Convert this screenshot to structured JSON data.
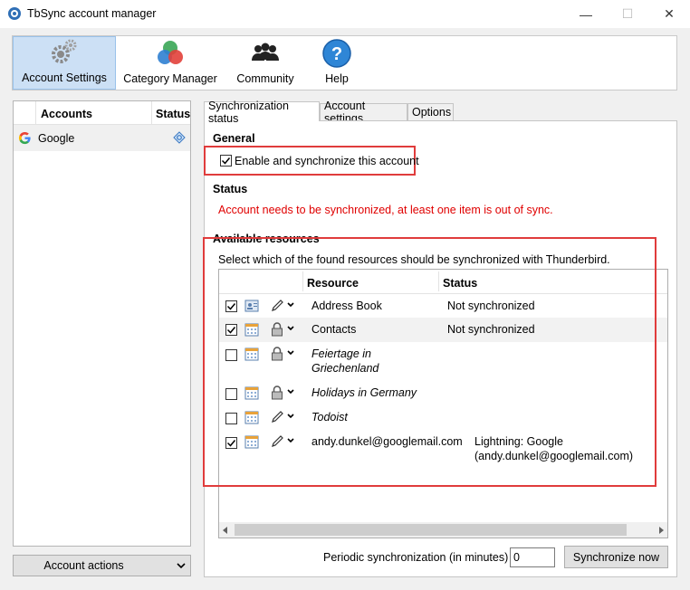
{
  "window": {
    "title": "TbSync account manager",
    "minimize": "—",
    "maximize": "☐",
    "close": "✕"
  },
  "toolbar": {
    "account_settings": "Account Settings",
    "category_manager": "Category Manager",
    "community": "Community",
    "help": "Help"
  },
  "accounts": {
    "col_accounts": "Accounts",
    "col_status": "Status",
    "items": [
      {
        "name": "Google",
        "icon": "google-icon",
        "status_icon": "sync-status-icon"
      }
    ],
    "actions_label": "Account actions"
  },
  "tabs": [
    "Synchronization status",
    "Account settings",
    "Options"
  ],
  "general": {
    "heading": "General",
    "enable_label": "Enable and synchronize this account",
    "enabled": true
  },
  "status": {
    "heading": "Status",
    "message": "Account needs to be synchronized, at least one item is out of sync.",
    "message_color": "#e00000"
  },
  "resources": {
    "heading": "Available resources",
    "description": "Select which of the found resources should be synchronized with Thunderbird.",
    "col_resource": "Resource",
    "col_status": "Status",
    "rows": [
      {
        "checked": true,
        "type_icon": "address-book-icon",
        "access_icon": "pencil-icon",
        "name": "Address Book",
        "status": "Not synchronized",
        "italic": false
      },
      {
        "checked": true,
        "type_icon": "calendar-icon",
        "access_icon": "lock-icon",
        "name": "Contacts",
        "status": "Not synchronized",
        "italic": false
      },
      {
        "checked": false,
        "type_icon": "calendar-icon",
        "access_icon": "lock-icon",
        "name_line1": "Feiertage in",
        "name_line2": "Griechenland",
        "status": "",
        "italic": true
      },
      {
        "checked": false,
        "type_icon": "calendar-icon",
        "access_icon": "lock-icon",
        "name": "Holidays in Germany",
        "status": "",
        "italic": true
      },
      {
        "checked": false,
        "type_icon": "calendar-icon",
        "access_icon": "pencil-icon",
        "name": "Todoist",
        "status": "",
        "italic": true
      },
      {
        "checked": true,
        "type_icon": "calendar-icon",
        "access_icon": "pencil-icon",
        "name": "andy.dunkel@googlemail.com",
        "status_line1": "Lightning: Google",
        "status_line2": "(andy.dunkel@googlemail.com)",
        "italic": false
      }
    ]
  },
  "periodic": {
    "label": "Periodic synchronization (in minutes)",
    "value": "0"
  },
  "sync_now": "Synchronize now",
  "highlight_color": "#e03c3c"
}
